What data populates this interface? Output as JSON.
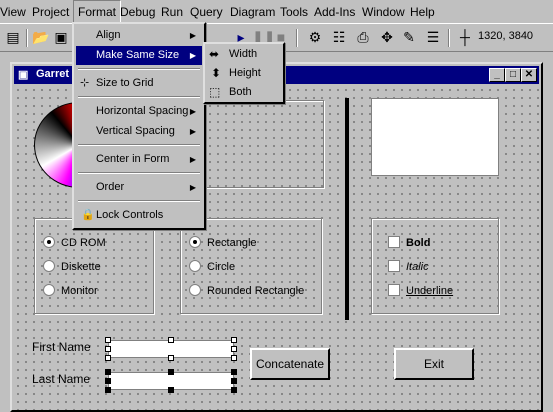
{
  "menubar": {
    "items": [
      "View",
      "Project",
      "Format",
      "Debug",
      "Run",
      "Query",
      "Diagram",
      "Tools",
      "Add-Ins",
      "Window",
      "Help"
    ]
  },
  "toolbar": {
    "coords": "1320, 3840"
  },
  "window": {
    "title": "Garret"
  },
  "format_menu": {
    "align": "Align",
    "make_same_size": "Make Same Size",
    "size_to_grid": "Size to Grid",
    "horizontal_spacing": "Horizontal Spacing",
    "vertical_spacing": "Vertical Spacing",
    "center_in_form": "Center in Form",
    "order": "Order",
    "lock_controls": "Lock Controls"
  },
  "size_submenu": {
    "width": "Width",
    "height": "Height",
    "both": "Both"
  },
  "drive_options": [
    "CD ROM",
    "Diskette",
    "Monitor"
  ],
  "drive_selected": "CD ROM",
  "shape_options": [
    "Rectangle",
    "Circle",
    "Rounded Rectangle"
  ],
  "shape_selected": "Rectangle",
  "font_options": [
    "Bold",
    "Italic",
    "Underline"
  ],
  "fields": {
    "first_name_label": "First Name",
    "last_name_label": "Last Name"
  },
  "buttons": {
    "concatenate": "Concatenate",
    "exit": "Exit"
  },
  "colors": {
    "titlebar": "#000080",
    "highlight": "#000080",
    "face": "#c0c0c0"
  }
}
